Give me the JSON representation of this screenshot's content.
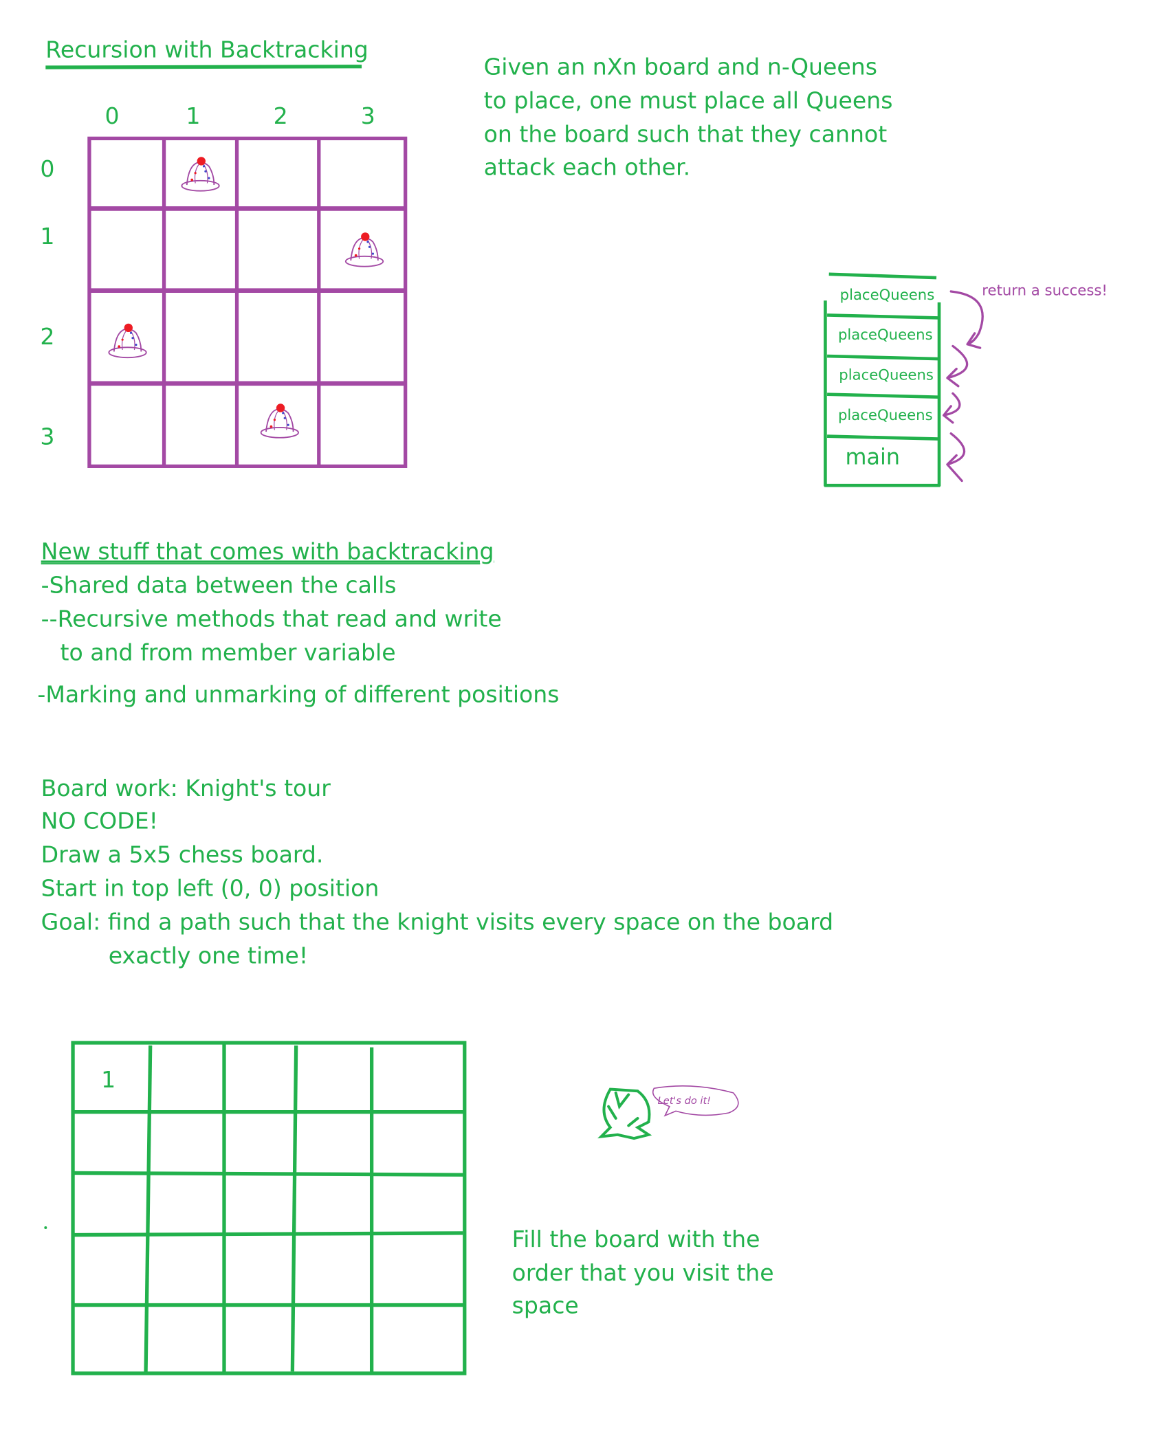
{
  "colors": {
    "ink_green": "#22b14c",
    "ink_purple": "#a349a4",
    "queen_red": "#ed1c24",
    "queen_blue": "#3f48cc"
  },
  "title": "Recursion with Backtracking",
  "intro": [
    "Given an nXn board and n-Queens",
    "to place, one must place all Queens",
    "on the board such that they cannot",
    "attack each other."
  ],
  "queens_board": {
    "col_labels": [
      "0",
      "1",
      "2",
      "3"
    ],
    "row_labels": [
      "0",
      "1",
      "2",
      "3"
    ],
    "queen_positions": [
      [
        0,
        1
      ],
      [
        1,
        3
      ],
      [
        2,
        0
      ],
      [
        3,
        2
      ]
    ],
    "icon": "queen-piece-icon"
  },
  "call_stack": {
    "frames": [
      "placeQueens",
      "placeQueens",
      "placeQueens",
      "placeQueens",
      "main"
    ],
    "annotation": "return a success!"
  },
  "new_stuff": {
    "heading": "New stuff that comes with backtracking",
    "lines": [
      "-Shared data between the calls",
      "--Recursive methods that read and write",
      "to and from member variable",
      "-Marking and unmarking of different positions"
    ]
  },
  "board_work": {
    "lines": [
      "Board work: Knight's tour",
      "NO CODE!",
      "Draw a 5x5 chess board.",
      "Start in top left (0, 0) position",
      "Goal: find a path such that the knight visits every space on the board",
      "exactly one time!"
    ]
  },
  "knight_board": {
    "first_cell": "1"
  },
  "doodle": {
    "speech": "Let's do it!",
    "icon": "dinosaur-doodle-icon"
  },
  "fill_note": [
    "Fill the board with the",
    "order that you visit the",
    "space"
  ]
}
